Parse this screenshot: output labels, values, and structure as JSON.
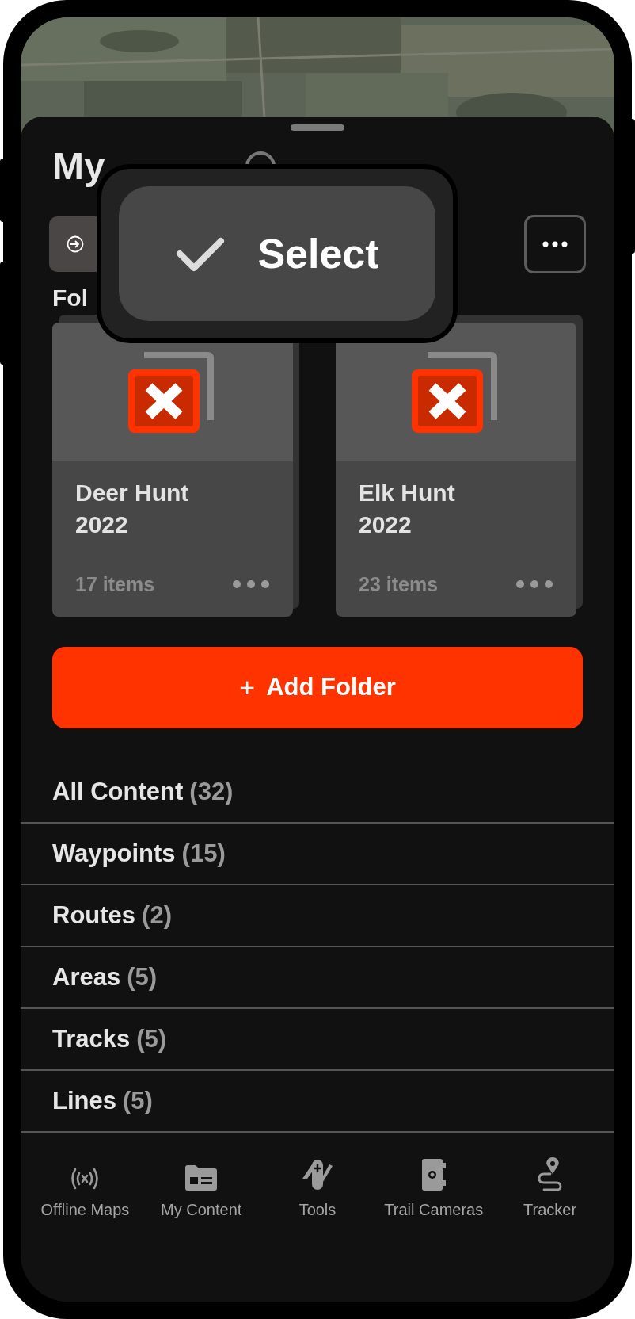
{
  "title": "My",
  "section_heading": "Fol",
  "popover": {
    "label": "Select"
  },
  "folders": [
    {
      "name": "Deer Hunt 2022",
      "count": "17 items"
    },
    {
      "name": "Elk Hunt 2022",
      "count": "23 items"
    }
  ],
  "add_folder": {
    "icon": "+",
    "label": "Add Folder"
  },
  "categories": [
    {
      "label": "All Content",
      "count": "(32)"
    },
    {
      "label": "Waypoints",
      "count": "(15)"
    },
    {
      "label": "Routes",
      "count": "(2)"
    },
    {
      "label": "Areas",
      "count": "(5)"
    },
    {
      "label": "Tracks",
      "count": "(5)"
    },
    {
      "label": "Lines",
      "count": "(5)"
    }
  ],
  "nav": [
    {
      "kind": "offline",
      "label": "Offline Maps"
    },
    {
      "kind": "content",
      "label": "My Content"
    },
    {
      "kind": "tools",
      "label": "Tools"
    },
    {
      "kind": "camera",
      "label": "Trail Cameras"
    },
    {
      "kind": "tracker",
      "label": "Tracker"
    }
  ]
}
